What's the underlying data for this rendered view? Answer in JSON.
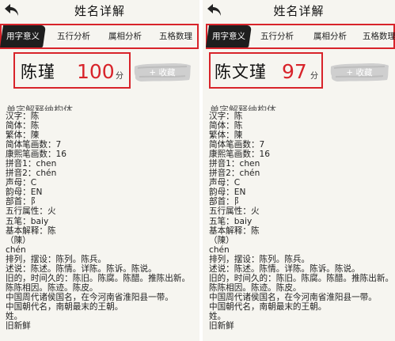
{
  "header": {
    "title": "姓名详解"
  },
  "tabs": [
    {
      "label": "用字意义"
    },
    {
      "label": "五行分析"
    },
    {
      "label": "属相分析"
    },
    {
      "label": "五格数理"
    }
  ],
  "fav_label": "+ 收藏",
  "score_unit": "分",
  "section_title": "单字解释纳构体",
  "colors": {
    "accent": "#d8232a",
    "active_tab": "#1e1e1e"
  },
  "left": {
    "name": "陈瑾",
    "score": "100",
    "lines": [
      "汉字：陈",
      "简体：陈",
      "繁体：陳",
      "简体笔画数：7",
      "康熙笔画数：16",
      "拼音1：chen",
      "拼音2：chén",
      "声母：C",
      "韵母：EN",
      "部首：阝",
      "五行属性：火",
      "五笔：baiy",
      "基本解释：陈",
      "（陳）",
      "chén",
      "排列，摆设：陈列。陈兵。",
      "述说：陈述。陈情。详陈。陈诉。陈说。",
      "旧的，时间久的：陈旧。陈腐。陈醋。推陈出新。",
      "陈陈相因。陈迹。陈皮。",
      "中国周代诸侯国名，在今河南省淮阳县一带。",
      "中国朝代名，南朝最末的王朝。",
      "姓。",
      "旧新鲜"
    ]
  },
  "right": {
    "name": "陈文瑾",
    "score": "97",
    "lines": [
      "汉字：陈",
      "简体：陈",
      "繁体：陳",
      "简体笔画数：7",
      "康熙笔画数：16",
      "拼音1：chen",
      "拼音2：chén",
      "声母：C",
      "韵母：EN",
      "部首：阝",
      "五行属性：火",
      "五笔：baiy",
      "基本解释：陈",
      "（陳）",
      "chén",
      "排列，摆设：陈列。陈兵。",
      "述说：陈述。陈情。详陈。陈诉。陈说。",
      "旧的，时间久的：陈旧。陈腐。陈醋。推陈出新。",
      "陈陈相因。陈迹。陈皮。",
      "中国周代诸侯国名，在今河南省淮阳县一带。",
      "中国朝代名，南朝最末的王朝。",
      "姓。",
      "旧新鲜"
    ]
  }
}
